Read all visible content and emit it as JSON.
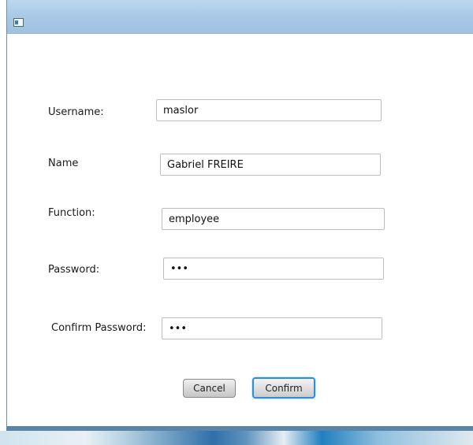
{
  "form": {
    "username": {
      "label": "Username:",
      "value": "maslor"
    },
    "name": {
      "label": "Name",
      "value": "Gabriel FREIRE"
    },
    "function": {
      "label": "Function:",
      "value": "employee"
    },
    "password": {
      "label": "Password:",
      "value": "•••"
    },
    "confirm_password": {
      "label": "Confirm Password:",
      "value": "•••"
    }
  },
  "buttons": {
    "cancel_label": "Cancel",
    "confirm_label": "Confirm"
  },
  "icons": {
    "app": "java-window-icon"
  },
  "colors": {
    "titlebar": "#a9c9e6",
    "focus_ring": "#2f8fd6"
  }
}
